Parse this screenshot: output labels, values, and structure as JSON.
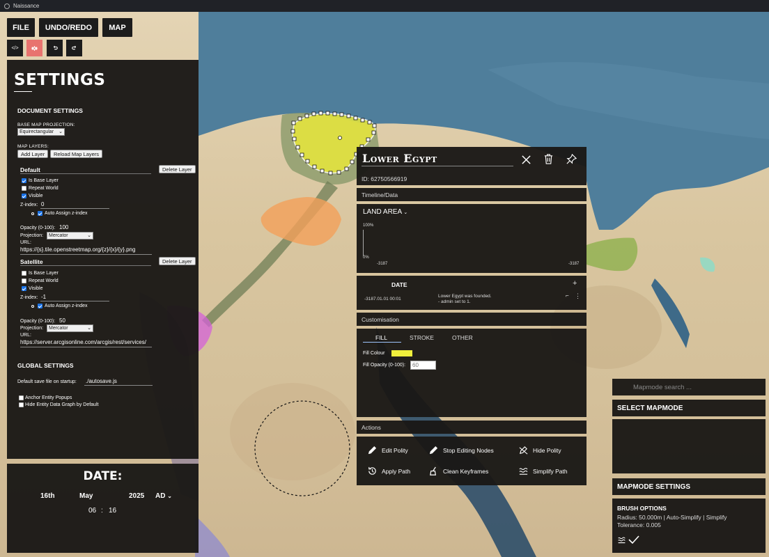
{
  "window": {
    "title": "Naissance"
  },
  "toolbar": {
    "file_label": "FILE",
    "undo_redo_label": "UNDO/REDO",
    "map_label": "MAP",
    "icons": [
      "code-icon",
      "gear-icon",
      "undo-icon",
      "redo-icon"
    ],
    "code_glyph": "</>",
    "accent_color": "#e8736f"
  },
  "settings": {
    "title": "SETTINGS",
    "document_settings": "DOCUMENT SETTINGS",
    "base_map_projection_label": "BASE MAP PROJECTION:",
    "base_map_projection_value": "Equirectangular",
    "map_layers_label": "MAP LAYERS:",
    "add_layer": "Add Layer",
    "reload_layers": "Reload Map Layers",
    "layers": [
      {
        "name": "Default",
        "delete_label": "Delete Layer",
        "is_base_layer": "Is Base Layer",
        "is_base_checked": true,
        "repeat_world": "Repeat World",
        "repeat_checked": false,
        "visible": "Visible",
        "visible_checked": true,
        "z_index_label": "Z-index:",
        "z_index": "0",
        "auto_assign": "Auto Assign z-index",
        "opacity_label": "Opacity (0-100):",
        "opacity": "100",
        "projection_label": "Projection:",
        "projection": "Mercator",
        "url_label": "URL:",
        "url": "https://{s}.tile.openstreetmap.org/{z}/{x}/{y}.png"
      },
      {
        "name": "Satellite",
        "delete_label": "Delete Layer",
        "is_base_layer": "Is Base Layer",
        "is_base_checked": false,
        "repeat_world": "Repeat World",
        "repeat_checked": false,
        "visible": "Visible",
        "visible_checked": true,
        "z_index_label": "Z-index:",
        "z_index": "-1",
        "auto_assign": "Auto Assign z-index",
        "opacity_label": "Opacity (0-100):",
        "opacity": "50",
        "projection_label": "Projection:",
        "projection": "Mercator",
        "url_label": "URL:",
        "url": "https://server.arcgisonline.com/arcgis/rest/services/"
      }
    ],
    "global_settings": "GLOBAL SETTINGS",
    "default_save_label": "Default save file on startup:",
    "default_save_value": "./autosave.js",
    "anchor_popups": "Anchor Entity Popups",
    "hide_graph": "Hide Entity Data Graph by Default"
  },
  "date": {
    "title": "DATE:",
    "day": "16th",
    "month": "May",
    "year": "2025",
    "era": "AD",
    "hour": "06",
    "separator": ":",
    "minute": "16"
  },
  "entity": {
    "name": "Lower Egypt",
    "id": "ID: 62750566919",
    "timeline_label": "Timeline/Data",
    "graph_title": "LAND AREA",
    "graph_top": "100%",
    "graph_bottom": "0%",
    "graph_x_start": "-3187",
    "graph_x_end": "-3187",
    "date_header": "DATE",
    "add_glyph": "+",
    "row_date": "-3187.01.01 00:01",
    "row_event_1": "Lower Egypt was founded.",
    "row_event_2": "- admin set to 1.",
    "customisation_label": "Customisation",
    "tabs": [
      "FILL",
      "STROKE",
      "OTHER"
    ],
    "fill_colour_label": "Fill Colour",
    "fill_colour": "#f0ef3c",
    "fill_opacity_label": "Fill Opacity (0-100):",
    "fill_opacity_value": "60",
    "actions_label": "Actions",
    "actions": [
      "Edit Polity",
      "Stop Editing Nodes",
      "Hide Polity",
      "Apply Path",
      "Clean Keyframes",
      "Simplify Path"
    ]
  },
  "mapmode": {
    "search_placeholder": "Mapmode search ...",
    "select_title": "SELECT MAPMODE",
    "settings_title": "MAPMODE SETTINGS",
    "brush_title": "BRUSH OPTIONS",
    "brush_line1": "Radius: 50.000m | Auto-Simplify | Simplify",
    "brush_line2": "Tolerance: 0.005"
  }
}
